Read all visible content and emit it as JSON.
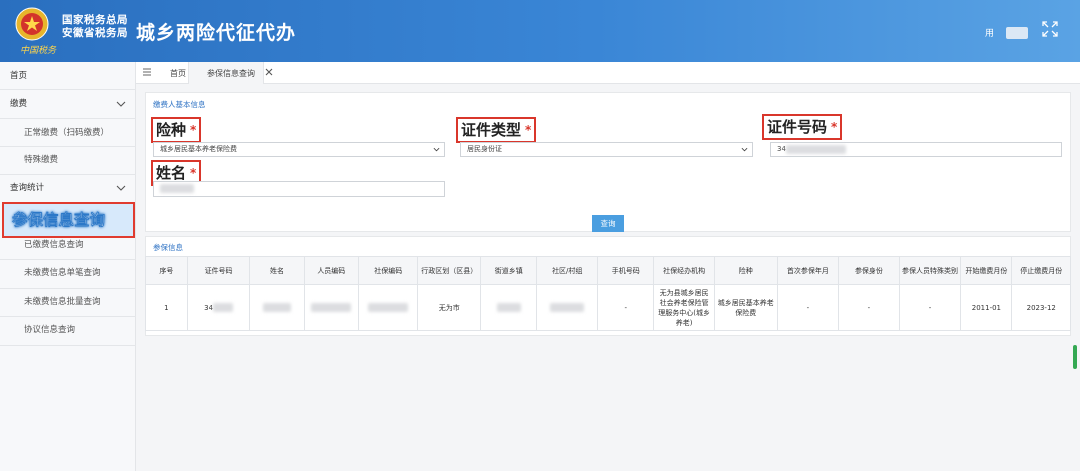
{
  "header": {
    "org_line1": "国家税务总局",
    "org_line2": "安徽省税务局",
    "signature": "中国税务",
    "app_title": "城乡两险代征代办",
    "user_label": "用"
  },
  "tabs": {
    "home": "首页",
    "active": "参保信息查询"
  },
  "sidebar": {
    "items": [
      {
        "label": "首页"
      },
      {
        "label": "缴费"
      },
      {
        "label": "正常缴费（扫码缴费）"
      },
      {
        "label": "特殊缴费"
      },
      {
        "label": "查询统计"
      },
      {
        "label": "参保信息查询"
      },
      {
        "label": "已缴费信息查询"
      },
      {
        "label": "未缴费信息单笔查询"
      },
      {
        "label": "未缴费信息批量查询"
      },
      {
        "label": "协议信息查询"
      }
    ]
  },
  "form": {
    "section_title": "缴费人基本信息",
    "insurance_label": "险种",
    "insurance_value": "城乡居民基本养老保险费",
    "id_type_label": "证件类型",
    "id_type_value": "居民身份证",
    "id_number_label": "证件号码",
    "id_number_value": "34",
    "name_label": "姓名",
    "required_mark": "*",
    "query_button": "查询"
  },
  "results": {
    "section_title": "参保信息",
    "columns": [
      "序号",
      "证件号码",
      "姓名",
      "人员编码",
      "社保编码",
      "行政区划（区县）",
      "街道乡镇",
      "社区/村组",
      "手机号码",
      "社保经办机构",
      "险种",
      "首次参保年月",
      "参保身份",
      "参保人员特殊类别",
      "开始缴费月份",
      "停止缴费月份"
    ],
    "rows": [
      {
        "index": "1",
        "id_number": "34",
        "district": "无为市",
        "phone": "-",
        "agency": "无为县城乡居民社会养老保险管理服务中心(城乡养老)",
        "insurance": "城乡居民基本养老保险费",
        "first_month": "-",
        "identity": "-",
        "special": "-",
        "start_month": "2011-01",
        "stop_month": "2023-12"
      }
    ]
  },
  "colors": {
    "header_blue": "#3a86d6",
    "highlight_red": "#d9362b",
    "button_blue": "#4a9ee0"
  }
}
